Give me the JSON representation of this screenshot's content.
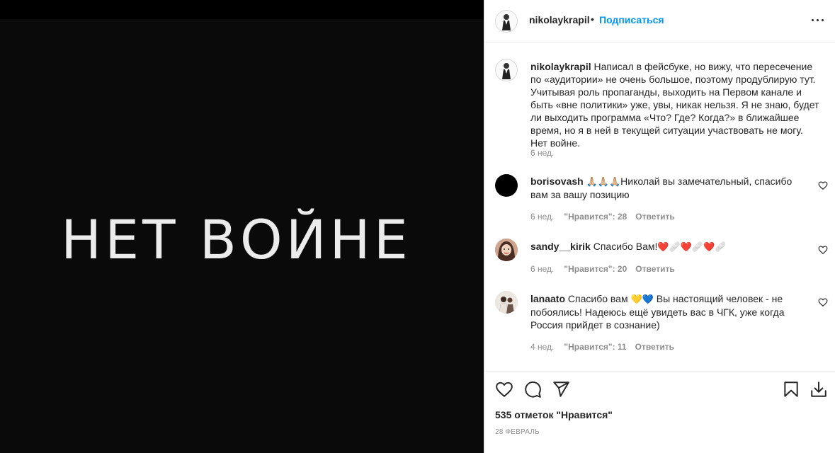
{
  "post": {
    "image_text": "НЕТ ВОЙНЕ",
    "author": "nikolaykrapil",
    "follow_label": "Подписаться",
    "dot": "•",
    "caption": "Написал в фейсбуке, но вижу, что пересечение по «аудитории» не очень большое, поэтому продублирую тут. Учитывая роль пропаганды, выходить на Первом канале и быть «вне политики» уже, увы, никак нельзя. Я не знаю, будет ли выходить программа «Что? Где? Когда?» в ближайшее время, но я в ней в текущей ситуации участвовать не могу. Нет войне.",
    "caption_time": "6 нед.",
    "likes": "535 отметок \"Нравится\"",
    "date": "28 ФЕВРАЛЬ"
  },
  "comments": [
    {
      "user": "borisovash",
      "emoji": "🙏🏼🙏🏼🙏🏼",
      "text": "Николай вы замечательный, спасибо вам за вашу позицию",
      "time": "6 нед.",
      "likes": "\"Нравится\": 28",
      "reply": "Ответить"
    },
    {
      "user": "sandy__kirik",
      "text": "Спасибо Вам!",
      "emoji": "❤️🩹❤️🩹❤️🩹",
      "time": "6 нед.",
      "likes": "\"Нравится\": 20",
      "reply": "Ответить"
    },
    {
      "user": "lanaato",
      "text": "Спасибо вам",
      "emoji": "💛💙",
      "text2": "Вы настоящий человек - не побоялись! Надеюсь ещё увидеть вас в ЧГК, уже когда Россия прийдет в сознание)",
      "time": "4 нед.",
      "likes": "\"Нравится\": 11",
      "reply": "Ответить"
    }
  ],
  "icons": {
    "like": "heart-icon",
    "comment": "comment-bubble-icon",
    "share": "paper-plane-icon",
    "save": "bookmark-icon",
    "download": "download-icon",
    "more": "more-dots-icon",
    "comment_like": "small-heart-icon"
  },
  "colors": {
    "accent": "#0095f6",
    "text": "#262626",
    "muted": "#8e8e8e",
    "image_bg": "#0a0a0a"
  }
}
